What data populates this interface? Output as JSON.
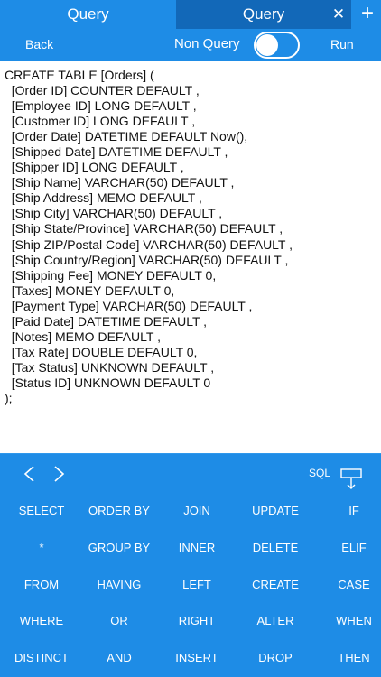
{
  "tabs": [
    {
      "label": "Query"
    },
    {
      "label": "Query"
    }
  ],
  "toolbar": {
    "back_label": "Back",
    "mode_label": "Non Query",
    "mode_enabled": false,
    "run_label": "Run"
  },
  "editor": {
    "lines": [
      "CREATE TABLE [Orders] (",
      "  [Order ID] COUNTER DEFAULT ,",
      "  [Employee ID] LONG DEFAULT ,",
      "  [Customer ID] LONG DEFAULT ,",
      "  [Order Date] DATETIME DEFAULT Now(),",
      "  [Shipped Date] DATETIME DEFAULT ,",
      "  [Shipper ID] LONG DEFAULT ,",
      "  [Ship Name] VARCHAR(50) DEFAULT ,",
      "  [Ship Address] MEMO DEFAULT ,",
      "  [Ship City] VARCHAR(50) DEFAULT ,",
      "  [Ship State/Province] VARCHAR(50) DEFAULT ,",
      "  [Ship ZIP/Postal Code] VARCHAR(50) DEFAULT ,",
      "  [Ship Country/Region] VARCHAR(50) DEFAULT ,",
      "  [Shipping Fee] MONEY DEFAULT 0,",
      "  [Taxes] MONEY DEFAULT 0,",
      "  [Payment Type] VARCHAR(50) DEFAULT ,",
      "  [Paid Date] DATETIME DEFAULT ,",
      "  [Notes] MEMO DEFAULT ,",
      "  [Tax Rate] DOUBLE DEFAULT 0,",
      "  [Tax Status] UNKNOWN DEFAULT ,",
      "  [Status ID] UNKNOWN DEFAULT 0",
      ");"
    ]
  },
  "keyboard": {
    "sql_label": "SQL",
    "keys": [
      [
        "SELECT",
        "ORDER BY",
        "JOIN",
        "UPDATE",
        "IF"
      ],
      [
        "*",
        "GROUP BY",
        "INNER",
        "DELETE",
        "ELIF"
      ],
      [
        "FROM",
        "HAVING",
        "LEFT",
        "CREATE",
        "CASE"
      ],
      [
        "WHERE",
        "OR",
        "RIGHT",
        "ALTER",
        "WHEN"
      ],
      [
        "DISTINCT",
        "AND",
        "INSERT",
        "DROP",
        "THEN"
      ]
    ]
  },
  "colors": {
    "accent": "#1e8ce6",
    "active_tab": "#1268b8"
  }
}
